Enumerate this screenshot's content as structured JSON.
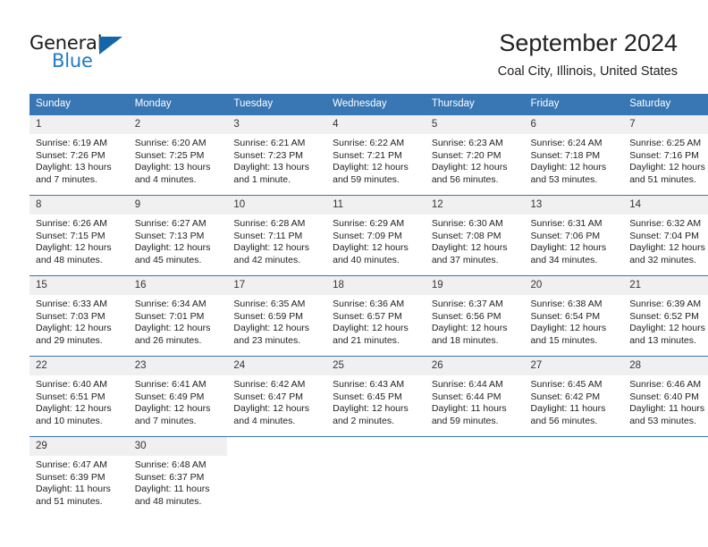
{
  "brand": {
    "name_top": "General",
    "name_bottom": "Blue",
    "triangle_icon": "triangle-icon",
    "color_dark": "#1a1a1a",
    "color_blue": "#1f7ac4"
  },
  "header": {
    "title": "September 2024",
    "subtitle": "Coal City, Illinois, United States"
  },
  "theme": {
    "header_blue": "#3876b4",
    "daynum_band": "#f0f0f0",
    "cell_bg": "#ffffff",
    "text": "#222222"
  },
  "calendar": {
    "weekday_headers": [
      "Sunday",
      "Monday",
      "Tuesday",
      "Wednesday",
      "Thursday",
      "Friday",
      "Saturday"
    ],
    "weeks": [
      [
        {
          "day": "1",
          "sunrise": "Sunrise: 6:19 AM",
          "sunset": "Sunset: 7:26 PM",
          "daylight_line1": "Daylight: 13 hours",
          "daylight_line2": "and 7 minutes."
        },
        {
          "day": "2",
          "sunrise": "Sunrise: 6:20 AM",
          "sunset": "Sunset: 7:25 PM",
          "daylight_line1": "Daylight: 13 hours",
          "daylight_line2": "and 4 minutes."
        },
        {
          "day": "3",
          "sunrise": "Sunrise: 6:21 AM",
          "sunset": "Sunset: 7:23 PM",
          "daylight_line1": "Daylight: 13 hours",
          "daylight_line2": "and 1 minute."
        },
        {
          "day": "4",
          "sunrise": "Sunrise: 6:22 AM",
          "sunset": "Sunset: 7:21 PM",
          "daylight_line1": "Daylight: 12 hours",
          "daylight_line2": "and 59 minutes."
        },
        {
          "day": "5",
          "sunrise": "Sunrise: 6:23 AM",
          "sunset": "Sunset: 7:20 PM",
          "daylight_line1": "Daylight: 12 hours",
          "daylight_line2": "and 56 minutes."
        },
        {
          "day": "6",
          "sunrise": "Sunrise: 6:24 AM",
          "sunset": "Sunset: 7:18 PM",
          "daylight_line1": "Daylight: 12 hours",
          "daylight_line2": "and 53 minutes."
        },
        {
          "day": "7",
          "sunrise": "Sunrise: 6:25 AM",
          "sunset": "Sunset: 7:16 PM",
          "daylight_line1": "Daylight: 12 hours",
          "daylight_line2": "and 51 minutes."
        }
      ],
      [
        {
          "day": "8",
          "sunrise": "Sunrise: 6:26 AM",
          "sunset": "Sunset: 7:15 PM",
          "daylight_line1": "Daylight: 12 hours",
          "daylight_line2": "and 48 minutes."
        },
        {
          "day": "9",
          "sunrise": "Sunrise: 6:27 AM",
          "sunset": "Sunset: 7:13 PM",
          "daylight_line1": "Daylight: 12 hours",
          "daylight_line2": "and 45 minutes."
        },
        {
          "day": "10",
          "sunrise": "Sunrise: 6:28 AM",
          "sunset": "Sunset: 7:11 PM",
          "daylight_line1": "Daylight: 12 hours",
          "daylight_line2": "and 42 minutes."
        },
        {
          "day": "11",
          "sunrise": "Sunrise: 6:29 AM",
          "sunset": "Sunset: 7:09 PM",
          "daylight_line1": "Daylight: 12 hours",
          "daylight_line2": "and 40 minutes."
        },
        {
          "day": "12",
          "sunrise": "Sunrise: 6:30 AM",
          "sunset": "Sunset: 7:08 PM",
          "daylight_line1": "Daylight: 12 hours",
          "daylight_line2": "and 37 minutes."
        },
        {
          "day": "13",
          "sunrise": "Sunrise: 6:31 AM",
          "sunset": "Sunset: 7:06 PM",
          "daylight_line1": "Daylight: 12 hours",
          "daylight_line2": "and 34 minutes."
        },
        {
          "day": "14",
          "sunrise": "Sunrise: 6:32 AM",
          "sunset": "Sunset: 7:04 PM",
          "daylight_line1": "Daylight: 12 hours",
          "daylight_line2": "and 32 minutes."
        }
      ],
      [
        {
          "day": "15",
          "sunrise": "Sunrise: 6:33 AM",
          "sunset": "Sunset: 7:03 PM",
          "daylight_line1": "Daylight: 12 hours",
          "daylight_line2": "and 29 minutes."
        },
        {
          "day": "16",
          "sunrise": "Sunrise: 6:34 AM",
          "sunset": "Sunset: 7:01 PM",
          "daylight_line1": "Daylight: 12 hours",
          "daylight_line2": "and 26 minutes."
        },
        {
          "day": "17",
          "sunrise": "Sunrise: 6:35 AM",
          "sunset": "Sunset: 6:59 PM",
          "daylight_line1": "Daylight: 12 hours",
          "daylight_line2": "and 23 minutes."
        },
        {
          "day": "18",
          "sunrise": "Sunrise: 6:36 AM",
          "sunset": "Sunset: 6:57 PM",
          "daylight_line1": "Daylight: 12 hours",
          "daylight_line2": "and 21 minutes."
        },
        {
          "day": "19",
          "sunrise": "Sunrise: 6:37 AM",
          "sunset": "Sunset: 6:56 PM",
          "daylight_line1": "Daylight: 12 hours",
          "daylight_line2": "and 18 minutes."
        },
        {
          "day": "20",
          "sunrise": "Sunrise: 6:38 AM",
          "sunset": "Sunset: 6:54 PM",
          "daylight_line1": "Daylight: 12 hours",
          "daylight_line2": "and 15 minutes."
        },
        {
          "day": "21",
          "sunrise": "Sunrise: 6:39 AM",
          "sunset": "Sunset: 6:52 PM",
          "daylight_line1": "Daylight: 12 hours",
          "daylight_line2": "and 13 minutes."
        }
      ],
      [
        {
          "day": "22",
          "sunrise": "Sunrise: 6:40 AM",
          "sunset": "Sunset: 6:51 PM",
          "daylight_line1": "Daylight: 12 hours",
          "daylight_line2": "and 10 minutes."
        },
        {
          "day": "23",
          "sunrise": "Sunrise: 6:41 AM",
          "sunset": "Sunset: 6:49 PM",
          "daylight_line1": "Daylight: 12 hours",
          "daylight_line2": "and 7 minutes."
        },
        {
          "day": "24",
          "sunrise": "Sunrise: 6:42 AM",
          "sunset": "Sunset: 6:47 PM",
          "daylight_line1": "Daylight: 12 hours",
          "daylight_line2": "and 4 minutes."
        },
        {
          "day": "25",
          "sunrise": "Sunrise: 6:43 AM",
          "sunset": "Sunset: 6:45 PM",
          "daylight_line1": "Daylight: 12 hours",
          "daylight_line2": "and 2 minutes."
        },
        {
          "day": "26",
          "sunrise": "Sunrise: 6:44 AM",
          "sunset": "Sunset: 6:44 PM",
          "daylight_line1": "Daylight: 11 hours",
          "daylight_line2": "and 59 minutes."
        },
        {
          "day": "27",
          "sunrise": "Sunrise: 6:45 AM",
          "sunset": "Sunset: 6:42 PM",
          "daylight_line1": "Daylight: 11 hours",
          "daylight_line2": "and 56 minutes."
        },
        {
          "day": "28",
          "sunrise": "Sunrise: 6:46 AM",
          "sunset": "Sunset: 6:40 PM",
          "daylight_line1": "Daylight: 11 hours",
          "daylight_line2": "and 53 minutes."
        }
      ],
      [
        {
          "day": "29",
          "sunrise": "Sunrise: 6:47 AM",
          "sunset": "Sunset: 6:39 PM",
          "daylight_line1": "Daylight: 11 hours",
          "daylight_line2": "and 51 minutes."
        },
        {
          "day": "30",
          "sunrise": "Sunrise: 6:48 AM",
          "sunset": "Sunset: 6:37 PM",
          "daylight_line1": "Daylight: 11 hours",
          "daylight_line2": "and 48 minutes."
        },
        {
          "day": "",
          "sunrise": "",
          "sunset": "",
          "daylight_line1": "",
          "daylight_line2": ""
        },
        {
          "day": "",
          "sunrise": "",
          "sunset": "",
          "daylight_line1": "",
          "daylight_line2": ""
        },
        {
          "day": "",
          "sunrise": "",
          "sunset": "",
          "daylight_line1": "",
          "daylight_line2": ""
        },
        {
          "day": "",
          "sunrise": "",
          "sunset": "",
          "daylight_line1": "",
          "daylight_line2": ""
        },
        {
          "day": "",
          "sunrise": "",
          "sunset": "",
          "daylight_line1": "",
          "daylight_line2": ""
        }
      ]
    ]
  }
}
